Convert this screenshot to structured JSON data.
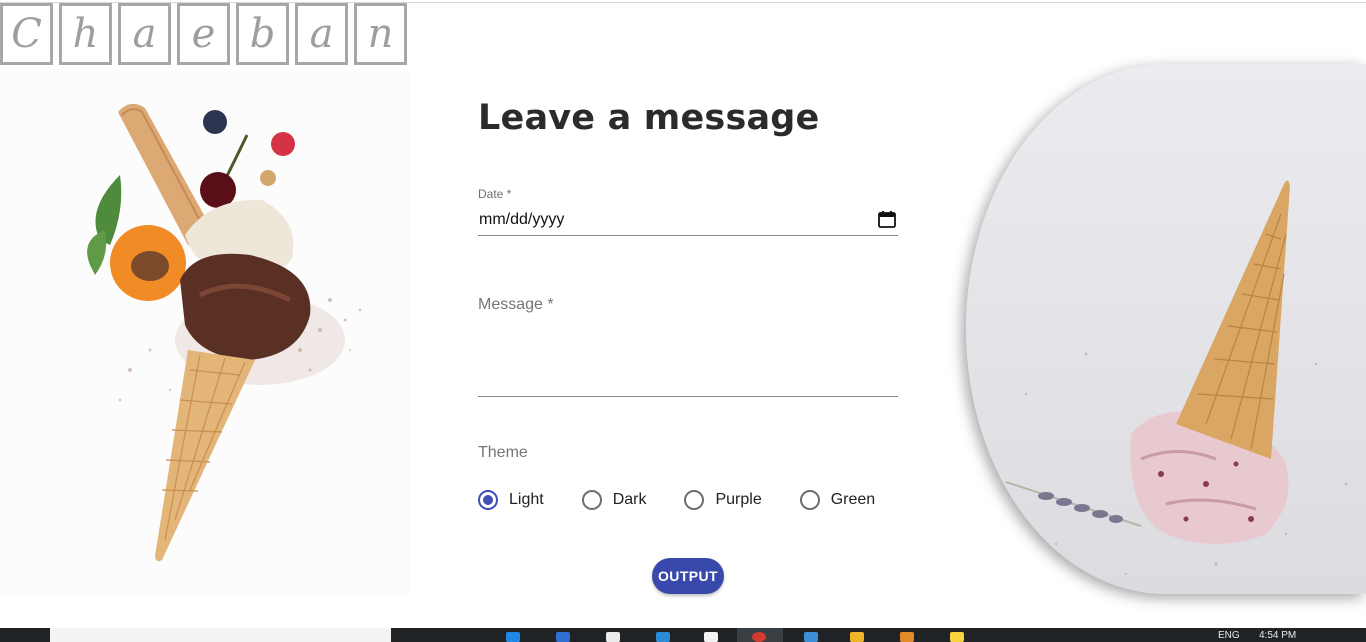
{
  "logo": {
    "letters": [
      "C",
      "h",
      "a",
      "e",
      "b",
      "a",
      "n"
    ]
  },
  "form": {
    "title": "Leave a message",
    "date_label": "Date *",
    "date_value": "mm/dd/yyyy",
    "message_label": "Message *",
    "theme_label": "Theme",
    "theme_options": [
      "Light",
      "Dark",
      "Purple",
      "Green"
    ],
    "theme_selected": "Light",
    "output_label": "OUTPUT"
  },
  "colors": {
    "accent": "#3f51b5",
    "button": "#3949ab",
    "text": "#2b2b2b",
    "muted": "#767676"
  },
  "taskbar": {
    "language": "ENG",
    "time": "4:54 PM"
  }
}
